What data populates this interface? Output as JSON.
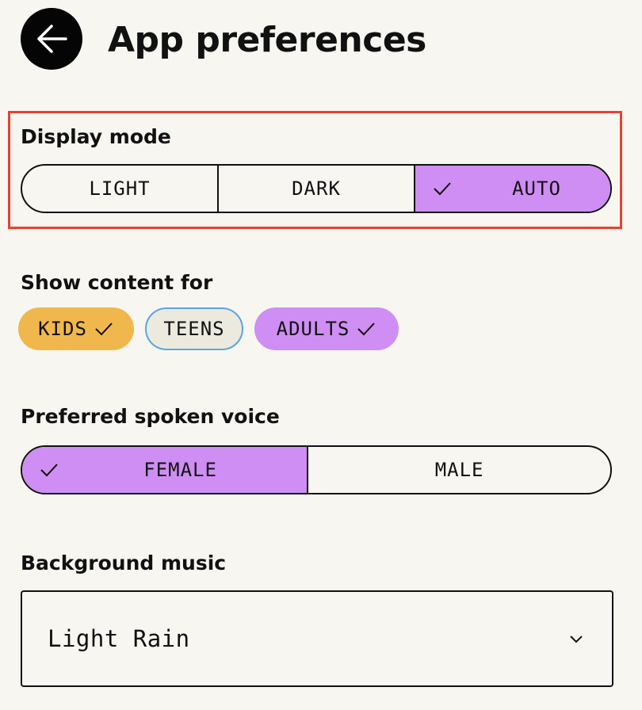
{
  "header": {
    "title": "App preferences",
    "back_icon": "arrow-left-icon"
  },
  "display_mode": {
    "label": "Display mode",
    "options": [
      "LIGHT",
      "DARK",
      "AUTO"
    ],
    "selected": "AUTO"
  },
  "content_for": {
    "label": "Show content for",
    "options": [
      {
        "label": "KIDS",
        "selected": true,
        "color": "#f0b84c"
      },
      {
        "label": "TEENS",
        "selected": false,
        "color": "#eceade"
      },
      {
        "label": "ADULTS",
        "selected": true,
        "color": "#cf8ef3"
      }
    ]
  },
  "voice": {
    "label": "Preferred spoken voice",
    "options": [
      "FEMALE",
      "MALE"
    ],
    "selected": "FEMALE"
  },
  "music": {
    "label": "Background music",
    "value": "Light Rain",
    "icon": "chevron-down-icon"
  },
  "colors": {
    "background": "#f7f6f1",
    "selected_purple": "#cf8ef3",
    "kids_yellow": "#f0b84c",
    "teens_border": "#5aa6e6",
    "highlight_red": "#e8412f"
  }
}
